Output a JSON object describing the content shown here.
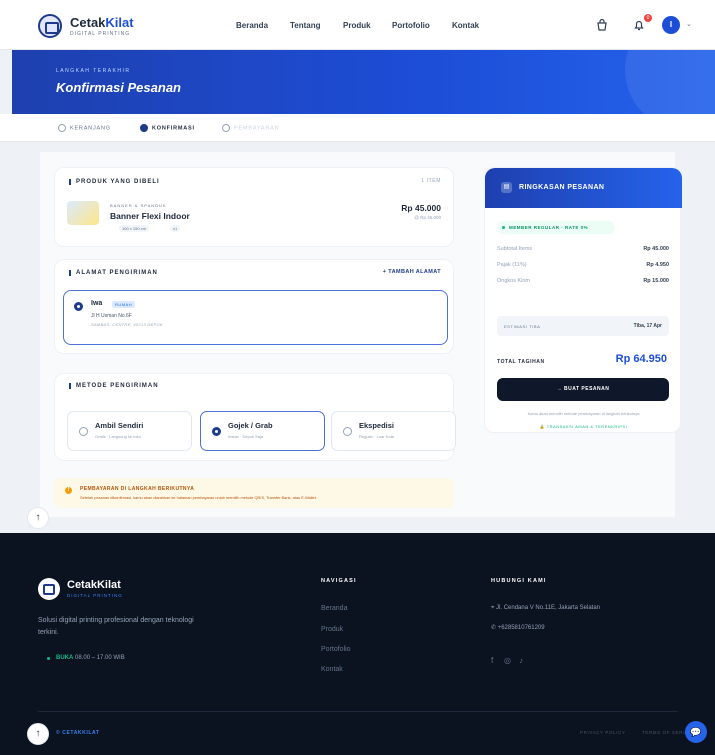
{
  "nav": {
    "brand_main": "Cetak",
    "brand_accent": "Kilat",
    "brand_sub": "DIGITAL PRINTING",
    "links": [
      "Beranda",
      "Tentang",
      "Produk",
      "Portofolio",
      "Kontak"
    ],
    "notif_count": "0",
    "avatar_initial": "I"
  },
  "hero": {
    "kicker": "LANGKAH TERAKHIR",
    "title": "Konfirmasi Pesanan"
  },
  "stepper": {
    "steps": [
      "KERANJANG",
      "KONFIRMASI",
      "PEMBAYARAN"
    ],
    "active_index": 1
  },
  "product": {
    "section_title": "PRODUK YANG DIBELI",
    "count": "1 ITEM",
    "kicker": "BANNER & SPANDUK",
    "name": "Banner Flexi Indoor",
    "size_chip": "100 x 150 cm",
    "qty_chip": "x1",
    "price": "Rp 45.000",
    "unit_price": "@ Rp 45.000"
  },
  "address": {
    "section_title": "ALAMAT PENGIRIMAN",
    "add_label": "+ TAMBAH ALAMAT",
    "name": "Iwa",
    "tag": "RUMAH",
    "line1": "Jl H Usman No.6F",
    "line2": "SAMBAS, CENTRE, 40213 DEPOK"
  },
  "shipping": {
    "section_title": "METODE PENGIRIMAN",
    "options": [
      {
        "name": "Ambil Sendiri",
        "sub": "Gratis · Langsung ke toko"
      },
      {
        "name": "Gojek / Grab",
        "sub": "Instan · Depok Saja"
      },
      {
        "name": "Ekspedisi",
        "sub": "Reguler · Luar Kota"
      }
    ],
    "selected_index": 1
  },
  "notice": {
    "title": "PEMBAYARAN DI LANGKAH BERIKUTNYA",
    "body": "Setelah pesanan dikonfirmasi, kamu akan diarahkan ke halaman pembayaran untuk memilih metode QRIS, Transfer Bank, atau E-Wallet."
  },
  "summary": {
    "title": "RINGKASAN PESANAN",
    "member": "MEMBER REGULAR · RATE 0%",
    "rows": [
      {
        "label": "Subtotal Items",
        "value": "Rp 45.000"
      },
      {
        "label": "Pajak (11%)",
        "value": "Rp 4.950"
      },
      {
        "label": "Ongkos Kirim",
        "value": "Rp 15.000"
      }
    ],
    "eta_label": "ESTIMASI TIBA",
    "eta_value": "Tiba, 17 Apr",
    "total_label": "TOTAL TAGIHAN",
    "total_value": "Rp 64.950",
    "buy_label": "→ BUAT PESANAN",
    "note": "Kamu akan memilih metode pembayaran di langkah berikutnya",
    "secure": "TRANSAKSI AMAN & TERENKRIPSI"
  },
  "footer": {
    "brand": "CetakKilat",
    "brand_sub": "DIGITAL PRINTING",
    "desc": "Solusi digital printing profesional dengan teknologi terkini.",
    "open_label": "BUKA",
    "open_hours": "08.00 – 17.00 WIB",
    "nav_title": "NAVIGASI",
    "nav_links": [
      "Beranda",
      "Produk",
      "Portofolio",
      "Kontak"
    ],
    "contact_title": "HUBUNGI KAMI",
    "address": "Jl. Cendana V No.11E, Jakarta Selatan",
    "phone": "+6285810761209",
    "copyright": "© CETAKKILAT",
    "privacy": "PRIVACY POLICY",
    "terms": "TERMS OF SERVICE"
  }
}
